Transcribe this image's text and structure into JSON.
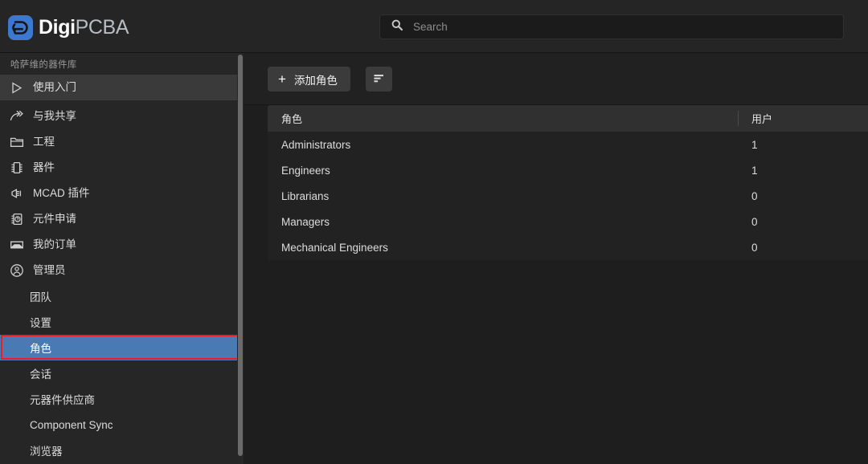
{
  "brand": {
    "name_bold": "Digi",
    "name_light": "PCBA",
    "logo_icon": "digipcba-logo-icon",
    "accent_color": "#3b78cf"
  },
  "search": {
    "icon": "search-icon",
    "placeholder": "Search",
    "value": ""
  },
  "sidebar": {
    "header": "哈萨维的器件库",
    "items": [
      {
        "label": "使用入门",
        "icon": "play-triangle-icon",
        "state": "hover"
      },
      {
        "label": "与我共享",
        "icon": "share-arrow-icon",
        "state": "normal"
      },
      {
        "label": "工程",
        "icon": "folder-icon",
        "state": "normal"
      },
      {
        "label": "器件",
        "icon": "chip-icon",
        "state": "normal"
      },
      {
        "label": "MCAD 插件",
        "icon": "plug-icon",
        "state": "normal"
      },
      {
        "label": "元件申请",
        "icon": "chip-question-icon",
        "state": "normal"
      },
      {
        "label": "我的订单",
        "icon": "inbox-tray-icon",
        "state": "normal"
      },
      {
        "label": "管理员",
        "icon": "user-circle-icon",
        "state": "normal"
      }
    ],
    "sub_items": [
      {
        "label": "团队",
        "state": "normal"
      },
      {
        "label": "设置",
        "state": "normal"
      },
      {
        "label": "角色",
        "state": "selected"
      },
      {
        "label": "会话",
        "state": "normal"
      },
      {
        "label": "元器件供应商",
        "state": "normal"
      },
      {
        "label": "Component Sync",
        "state": "normal"
      },
      {
        "label": "浏览器",
        "state": "normal"
      }
    ],
    "selected_color": "#4a7ab3",
    "highlight_color": "#ee1b24"
  },
  "toolbar": {
    "add_role_label": "添加角色",
    "add_role_icon": "plus-icon",
    "sort_icon": "sort-lines-icon"
  },
  "table": {
    "columns": [
      "角色",
      "用户"
    ],
    "rows": [
      {
        "role": "Administrators",
        "users": "1"
      },
      {
        "role": "Engineers",
        "users": "1"
      },
      {
        "role": "Librarians",
        "users": "0"
      },
      {
        "role": "Managers",
        "users": "0"
      },
      {
        "role": "Mechanical Engineers",
        "users": "0"
      }
    ]
  }
}
